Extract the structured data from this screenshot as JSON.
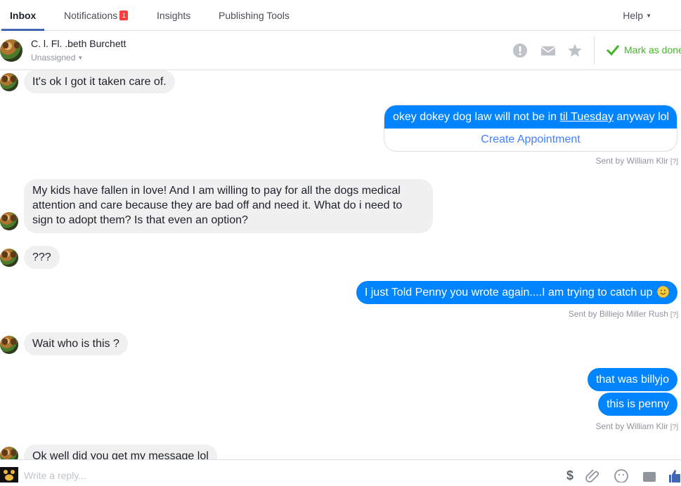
{
  "nav": {
    "tabs": [
      {
        "label": "Inbox"
      },
      {
        "label": "Notifications",
        "badge": "1"
      },
      {
        "label": "Insights"
      },
      {
        "label": "Publishing Tools"
      }
    ],
    "help_label": "Help"
  },
  "header": {
    "contact_name": "C. l. Fl.  .beth Burchett",
    "assignment": "Unassigned",
    "mark_done_label": "Mark as done"
  },
  "messages": {
    "m1": "It's ok I got it taken care of.",
    "m2_pre": "okey dokey dog law will not be in ",
    "m2_link": "til Tuesday",
    "m2_post": " anyway lol",
    "m2_action": "Create Appointment",
    "m2_sentby": "Sent by William Klir",
    "m3": "My kids have fallen in love! And I am willing to pay for all the dogs medical attention and care because they are bad off and need it. What do i need to sign to adopt them? Is that even an option?",
    "m4": "???",
    "m5": "I just Told Penny you wrote again....I am trying to catch up",
    "m5_sentby": "Sent by Billiejo Miller Rush",
    "m6": "Wait who is this ?",
    "m7": "that was billyjo",
    "m8": "this is penny",
    "m8_sentby": "Sent by William Klir",
    "m9": "Ok well did you get my message lol",
    "help_marker": "[?]"
  },
  "composer": {
    "placeholder": "Write a reply..."
  },
  "colors": {
    "accent": "#4267b2",
    "outgoing_bubble": "#0084ff",
    "incoming_bubble": "#f1f0f0",
    "done_green": "#42b72a",
    "badge_red": "#fa3e3e"
  },
  "icons": [
    "exclamation-circle-icon",
    "envelope-icon",
    "star-icon",
    "checkmark-icon",
    "dollar-icon",
    "paperclip-icon",
    "emoji-icon",
    "sticker-icon",
    "thumbs-up-icon"
  ]
}
